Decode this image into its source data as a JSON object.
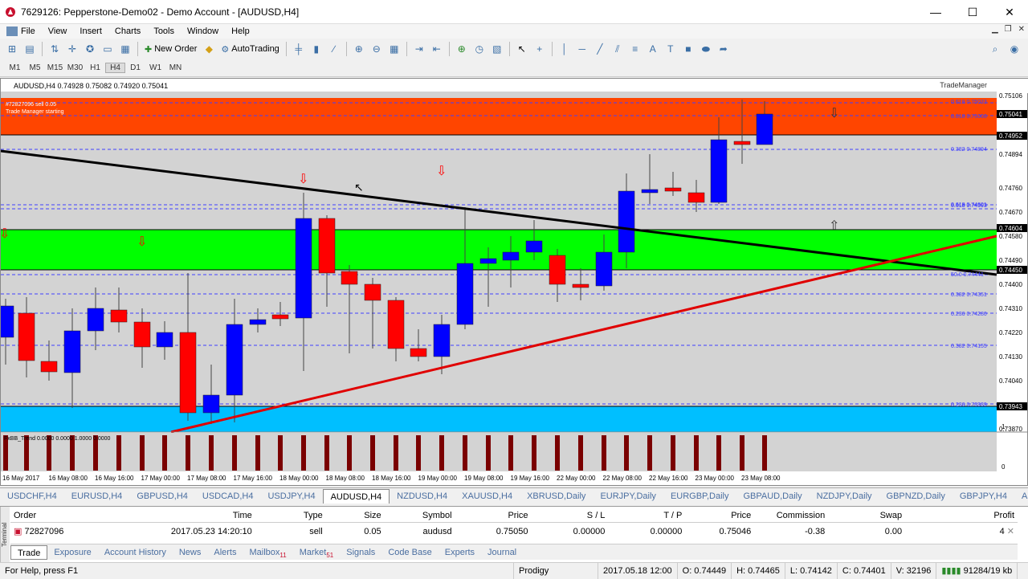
{
  "window": {
    "title": "7629126: Pepperstone-Demo02 - Demo Account - [AUDUSD,H4]",
    "controls": [
      "—",
      "☐",
      "✕"
    ]
  },
  "menu": [
    "File",
    "View",
    "Insert",
    "Charts",
    "Tools",
    "Window",
    "Help"
  ],
  "toolbar": {
    "new_order": "New Order",
    "autotrading": "AutoTrading"
  },
  "timeframes": [
    "M1",
    "M5",
    "M15",
    "M30",
    "H1",
    "H4",
    "D1",
    "W1",
    "MN"
  ],
  "active_timeframe": "H4",
  "chart": {
    "header": "AUDUSD,H4  0.74928 0.75082 0.74920 0.75041",
    "trade_manager": "TradeManager",
    "status_lines": [
      "#72827096 sell 0.05",
      "Trade Manager starting"
    ],
    "indicator_label": "FxBB_Trend 0.0000 0.0000 1.0000 0.0000",
    "price_labels": [
      "0.75106",
      "0.75041",
      "0.74952",
      "0.74894",
      "0.74760",
      "0.74670",
      "0.74604",
      "0.74580",
      "0.74490",
      "0.74450",
      "0.74400",
      "0.74310",
      "0.74220",
      "0.74130",
      "0.74040",
      "0.73943",
      "0.73870"
    ],
    "highlight_prices": [
      "0.75041",
      "0.74952",
      "0.74604",
      "0.74450",
      "0.73943"
    ],
    "fib_labels": [
      "0.618  0.75033",
      "0.618  0.75006",
      "0.382  0.74894",
      "0.618  0.74601",
      "0.618  0.74593",
      "50.0  0.74441",
      "0.382  0.74351",
      "0.236  0.74280",
      "0.382  0.74155",
      "0.236  0.73939"
    ],
    "date_labels": [
      "16 May 2017",
      "16 May 08:00",
      "16 May 16:00",
      "17 May 00:00",
      "17 May 08:00",
      "17 May 16:00",
      "18 May 00:00",
      "18 May 08:00",
      "18 May 16:00",
      "19 May 00:00",
      "19 May 08:00",
      "19 May 16:00",
      "22 May 00:00",
      "22 May 08:00",
      "22 May 16:00",
      "23 May 00:00",
      "23 May 08:00"
    ],
    "indicator_scale": [
      "1",
      "0"
    ],
    "colors": {
      "bull": "#0000ff",
      "bear": "#ff0000",
      "green_zone": "#00ff00",
      "red_zone": "#ff4500",
      "blue_zone": "#00bfff",
      "background": "#d3d3d3"
    }
  },
  "symbol_tabs": [
    "USDCHF,H4",
    "EURUSD,H4",
    "GBPUSD,H4",
    "USDCAD,H4",
    "USDJPY,H4",
    "AUDUSD,H4",
    "NZDUSD,H4",
    "XAUUSD,H4",
    "XBRUSD,Daily",
    "EURJPY,Daily",
    "EURGBP,Daily",
    "GBPAUD,Daily",
    "NZDJPY,Daily",
    "GBPNZD,Daily",
    "GBPJPY,H4",
    "AUDNZ"
  ],
  "active_symbol": "AUDUSD,H4",
  "terminal": {
    "side_label": "Terminal",
    "columns": {
      "order": "Order",
      "time": "Time",
      "type": "Type",
      "size": "Size",
      "symbol": "Symbol",
      "price": "Price",
      "sl": "S / L",
      "tp": "T / P",
      "price2": "Price",
      "comm": "Commission",
      "swap": "Swap",
      "profit": "Profit"
    },
    "row": {
      "order": "72827096",
      "time": "2017.05.23 14:20:10",
      "type": "sell",
      "size": "0.05",
      "symbol": "audusd",
      "price": "0.75050",
      "sl": "0.00000",
      "tp": "0.00000",
      "price2": "0.75046",
      "comm": "-0.38",
      "swap": "0.00",
      "profit": "4"
    },
    "tabs": [
      "Trade",
      "Exposure",
      "Account History",
      "News",
      "Alerts",
      "Mailbox",
      "Market",
      "Signals",
      "Code Base",
      "Experts",
      "Journal"
    ],
    "tab_badges": {
      "Mailbox": "11",
      "Market": "51"
    },
    "active_tab": "Trade"
  },
  "status": {
    "help": "For Help, press F1",
    "profile": "Prodigy",
    "time": "2017.05.18 12:00",
    "open": "O: 0.74449",
    "high": "H: 0.74465",
    "low": "L: 0.74142",
    "close": "C: 0.74401",
    "volume": "V: 32196",
    "traffic": "91284/19 kb"
  }
}
